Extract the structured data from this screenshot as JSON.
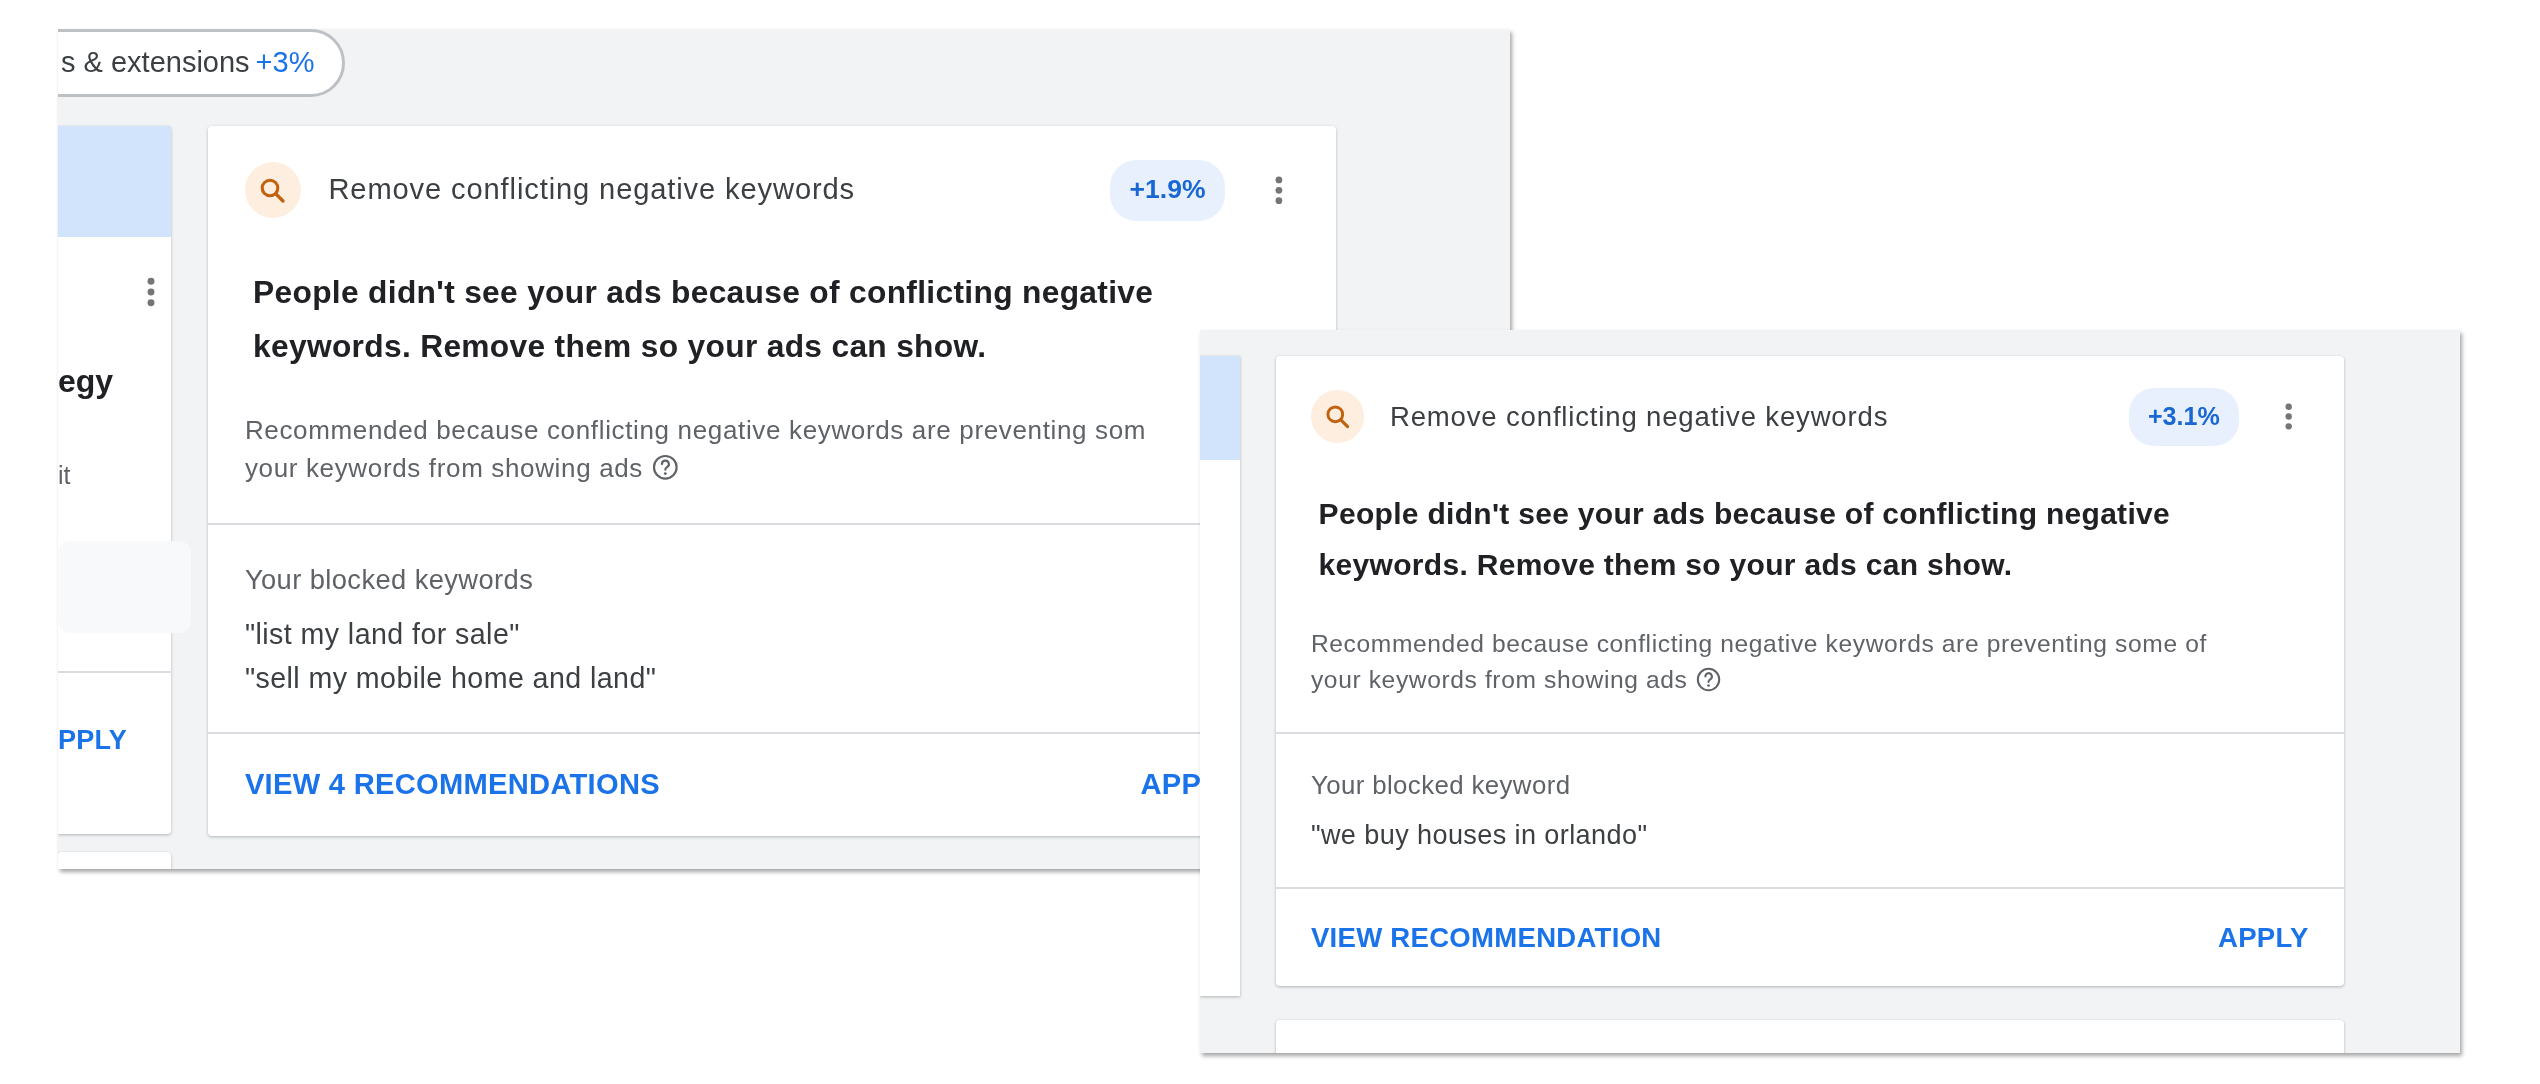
{
  "panels": [
    {
      "chip": {
        "label": "s & extensions",
        "uplift": "+3%"
      },
      "side_card": {
        "title": "egy",
        "text": "it",
        "action": "PPLY"
      },
      "card": {
        "category": "Remove conflicting negative keywords",
        "uplift": "+1.9%",
        "headline": "People didn't see your ads because of conflicting negative\nkeywords. Remove them so your ads can show.",
        "reason_lines": [
          "Recommended because conflicting negative keywords are preventing som",
          "your keywords from showing ads"
        ],
        "keywords_label": "Your blocked keywords",
        "keywords": [
          "\"list my land for sale\"",
          "\"sell my mobile home and land\""
        ],
        "primary_action": "VIEW 4 RECOMMENDATIONS",
        "secondary_action": "APP"
      }
    },
    {
      "card": {
        "category": "Remove conflicting negative keywords",
        "uplift": "+3.1%",
        "headline": "People didn't see your ads because of conflicting negative\nkeywords. Remove them so your ads can show.",
        "reason_lines": [
          "Recommended because conflicting negative keywords are preventing some of",
          "your keywords from showing ads"
        ],
        "keywords_label": "Your blocked keyword",
        "keywords": [
          "\"we buy houses in orlando\""
        ],
        "primary_action": "VIEW RECOMMENDATION",
        "secondary_action": "APPLY"
      }
    }
  ]
}
